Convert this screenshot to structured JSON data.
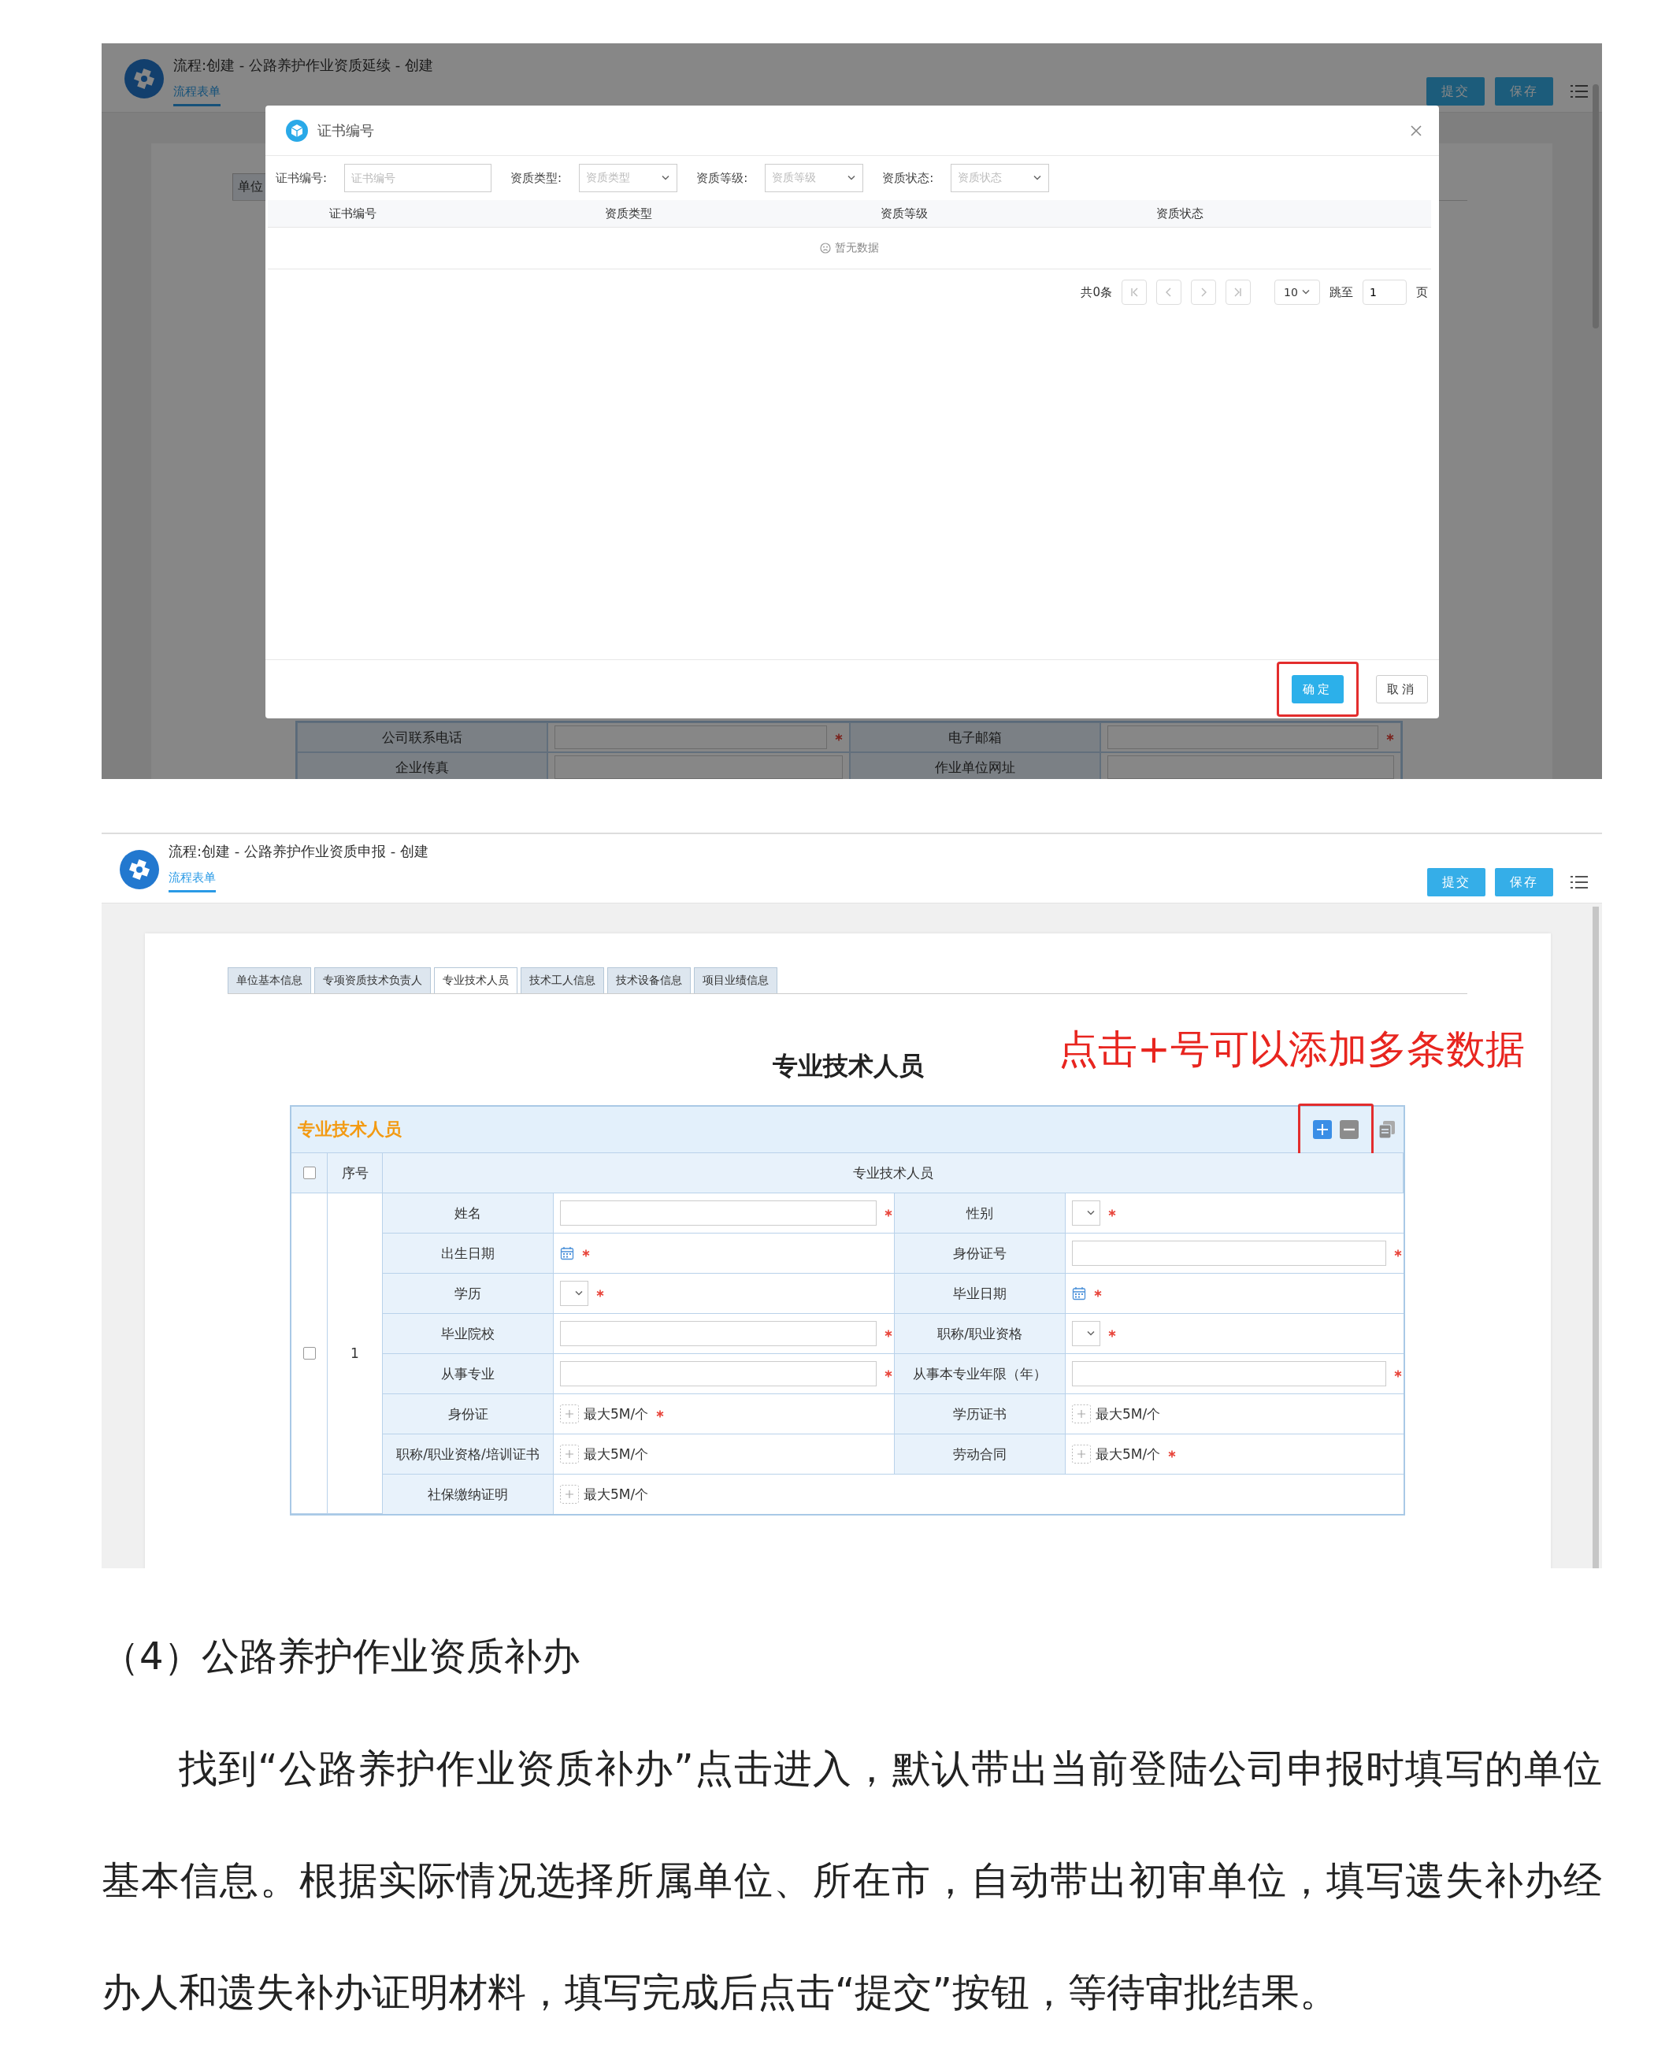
{
  "screen_1": {
    "header": {
      "title": "流程:创建 - 公路养护作业资质延续 - 创建",
      "tab": "流程表单",
      "buttons": [
        "提交",
        "保存"
      ]
    },
    "background": {
      "tab": "单位",
      "rows": [
        {
          "label_1": "公司联系电话",
          "required_1": true,
          "label_2": "电子邮箱",
          "required_2": true
        },
        {
          "label_1": "企业传真",
          "label_2": "作业单位网址"
        }
      ]
    },
    "dialog": {
      "title": "证书编号",
      "filters": [
        {
          "kind": "input",
          "label": "证书编号:",
          "placeholder": "证书编号"
        },
        {
          "kind": "select",
          "label": "资质类型:",
          "placeholder": "资质类型"
        },
        {
          "kind": "select",
          "label": "资质等级:",
          "placeholder": "资质等级"
        },
        {
          "kind": "select",
          "label": "资质状态:",
          "placeholder": "资质状态"
        }
      ],
      "columns": [
        "证书编号",
        "资质类型",
        "资质等级",
        "资质状态"
      ],
      "empty_text": "暂无数据",
      "pagination": {
        "total": "共0条",
        "page_size": "10",
        "jump_label": "跳至",
        "page": "1",
        "unit": "页"
      },
      "buttons": [
        {
          "kind": "primary",
          "label": "确定",
          "highlighted": true
        },
        {
          "kind": "default",
          "label": "取消",
          "highlighted": false
        }
      ]
    }
  },
  "screen_2": {
    "header": {
      "title": "流程:创建 - 公路养护作业资质申报 - 创建",
      "tab": "流程表单",
      "buttons": [
        "提交",
        "保存"
      ]
    },
    "tabs": [
      {
        "label": "单位基本信息",
        "selected": false
      },
      {
        "label": "专项资质技术负责人",
        "selected": false
      },
      {
        "label": "专业技术人员",
        "selected": true
      },
      {
        "label": "技术工人信息",
        "selected": false
      },
      {
        "label": "技术设备信息",
        "selected": false
      },
      {
        "label": "项目业绩信息",
        "selected": false
      }
    ],
    "heading": "专业技术人员",
    "annotation": "点击+号可以添加多条数据",
    "table": {
      "title": "专业技术人员",
      "toolbar_highlighted": true,
      "header_checked": false,
      "columns": [
        "序号",
        "专业技术人员"
      ],
      "rows": [
        {
          "checked": false,
          "index": "1",
          "fields": [
            {
              "label": "姓名",
              "kind": "text",
              "required": true
            },
            {
              "label": "性别",
              "kind": "select",
              "required": true
            },
            {
              "label": "出生日期",
              "kind": "date",
              "required": true
            },
            {
              "label": "身份证号",
              "kind": "text",
              "required": true
            },
            {
              "label": "学历",
              "kind": "select",
              "required": true
            },
            {
              "label": "毕业日期",
              "kind": "date",
              "required": true
            },
            {
              "label": "毕业院校",
              "kind": "text",
              "required": true
            },
            {
              "label": "职称/职业资格",
              "kind": "select",
              "required": true
            },
            {
              "label": "从事专业",
              "kind": "text",
              "required": true
            },
            {
              "label": "从事本专业年限（年）",
              "kind": "text",
              "required": true
            },
            {
              "label": "身份证",
              "kind": "upload",
              "hint": "最大5M/个",
              "required": true
            },
            {
              "label": "学历证书",
              "kind": "upload",
              "hint": "最大5M/个"
            },
            {
              "label": "职称/职业资格/培训证书",
              "kind": "upload",
              "hint": "最大5M/个"
            },
            {
              "label": "劳动合同",
              "kind": "upload",
              "hint": "最大5M/个",
              "required": true
            },
            {
              "label": "社保缴纳证明",
              "kind": "upload",
              "hint": "最大5M/个"
            }
          ]
        }
      ]
    }
  },
  "section_heading": "（4）公路养护作业资质补办",
  "paragraph": "找到“公路养护作业资质补办”点击进入，默认带出当前登陆公司申报时填写的单位基本信息。根据实际情况选择所属单位、所在市，自动带出初审单位，填写遗失补办经办人和遗失补办证明材料，填写完成后点击“提交”按钮，等待审批结果。"
}
